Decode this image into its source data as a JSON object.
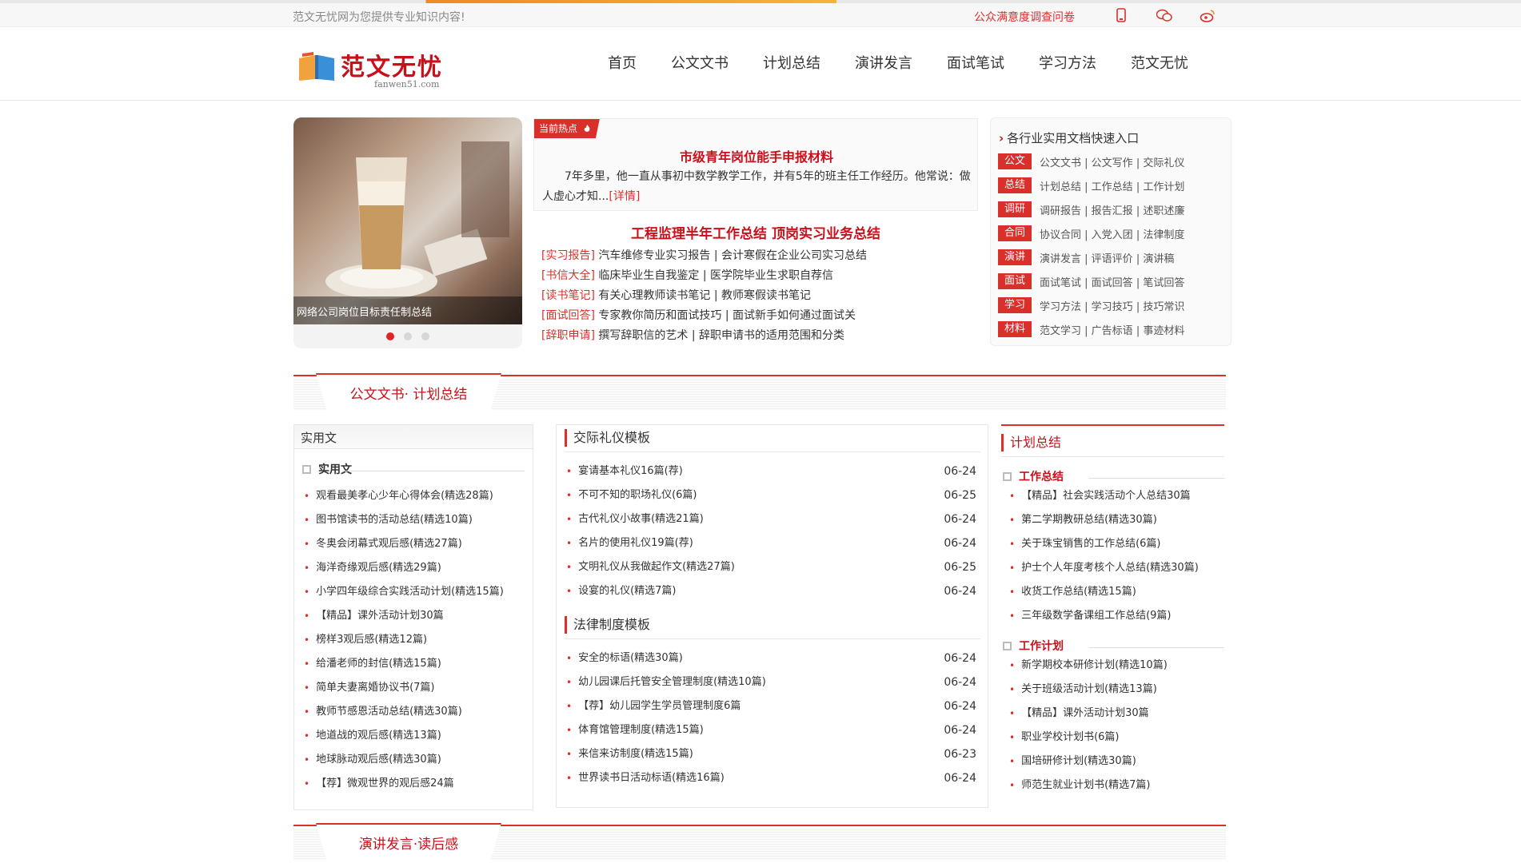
{
  "topbar": {
    "welcome": "范文无忧网为您提供专业知识内容!",
    "survey": "公众满意度调查问卷"
  },
  "logo": {
    "name": "范文无忧",
    "domain": "fanwen51.com"
  },
  "nav": [
    "首页",
    "公文文书",
    "计划总结",
    "演讲发言",
    "面试笔试",
    "学习方法",
    "范文无忧"
  ],
  "slider": {
    "caption": "网络公司岗位目标责任制总结",
    "slide_count": 3,
    "active": 1
  },
  "hot": {
    "tag": "当前热点",
    "title": "市级青年岗位能手申报材料",
    "desc": "7年多里，他一直从事初中数学教学工作，并有5年的班主任工作经历。他常说：做人虚心才知...",
    "more": "[详情]"
  },
  "headline": "工程监理半年工作总结 顶岗实习业务总结",
  "hotlist": [
    {
      "cat": "[实习报告]",
      "links": [
        "汽车维修专业实习报告",
        "会计寒假在企业公司实习总结"
      ]
    },
    {
      "cat": "[书信大全]",
      "links": [
        "临床毕业生自我鉴定",
        "医学院毕业生求职自荐信"
      ]
    },
    {
      "cat": "[读书笔记]",
      "links": [
        "有关心理教师读书笔记",
        "教师寒假读书笔记"
      ]
    },
    {
      "cat": "[面试回答]",
      "links": [
        "专家教你简历和面试技巧",
        "面试新手如何通过面试关"
      ]
    },
    {
      "cat": "[辞职申请]",
      "links": [
        "撰写辞职信的艺术",
        "辞职申请书的适用范围和分类"
      ]
    }
  ],
  "quick": {
    "title": "各行业实用文档快速入口",
    "rows": [
      {
        "tag": "公文",
        "links": [
          "公文文书",
          "公文写作",
          "交际礼仪"
        ]
      },
      {
        "tag": "总结",
        "links": [
          "计划总结",
          "工作总结",
          "工作计划"
        ]
      },
      {
        "tag": "调研",
        "links": [
          "调研报告",
          "报告汇报",
          "述职述廉"
        ]
      },
      {
        "tag": "合同",
        "links": [
          "协议合同",
          "入党入团",
          "法律制度"
        ]
      },
      {
        "tag": "演讲",
        "links": [
          "演讲发言",
          "评语评价",
          "演讲稿"
        ]
      },
      {
        "tag": "面试",
        "links": [
          "面试笔试",
          "面试回答",
          "笔试回答"
        ]
      },
      {
        "tag": "学习",
        "links": [
          "学习方法",
          "学习技巧",
          "技巧常识"
        ]
      },
      {
        "tag": "材料",
        "links": [
          "范文学习",
          "广告标语",
          "事迹材料"
        ]
      }
    ]
  },
  "section1": {
    "title": "公文文书· 计划总结"
  },
  "section2": {
    "title": "演讲发言·读后感"
  },
  "colA": {
    "header": "实用文",
    "subhead": "实用文",
    "items": [
      "观看最美孝心少年心得体会(精选28篇)",
      "图书馆读书的活动总结(精选10篇)",
      "冬奥会闭幕式观后感(精选27篇)",
      "海洋奇缘观后感(精选29篇)",
      "小学四年级综合实践活动计划(精选15篇)",
      "【精品】课外活动计划30篇",
      "榜样3观后感(精选12篇)",
      "给潘老师的封信(精选15篇)",
      "简单夫妻离婚协议书(7篇)",
      "教师节感恩活动总结(精选30篇)",
      "地道战的观后感(精选13篇)",
      "地球脉动观后感(精选30篇)",
      "【荐】微观世界的观后感24篇"
    ]
  },
  "colB": {
    "group1": {
      "title": "交际礼仪模板",
      "items": [
        {
          "text": "宴请基本礼仪16篇(荐)",
          "date": "06-24"
        },
        {
          "text": "不可不知的职场礼仪(6篇)",
          "date": "06-25"
        },
        {
          "text": "古代礼仪小故事(精选21篇)",
          "date": "06-24"
        },
        {
          "text": "名片的使用礼仪19篇(荐)",
          "date": "06-24"
        },
        {
          "text": "文明礼仪从我做起作文(精选27篇)",
          "date": "06-25"
        },
        {
          "text": "设宴的礼仪(精选7篇)",
          "date": "06-24"
        }
      ]
    },
    "group2": {
      "title": "法律制度模板",
      "items": [
        {
          "text": "安全的标语(精选30篇)",
          "date": "06-24"
        },
        {
          "text": "幼儿园课后托管安全管理制度(精选10篇)",
          "date": "06-24"
        },
        {
          "text": "【荐】幼儿园学生学员管理制度6篇",
          "date": "06-24"
        },
        {
          "text": "体育馆管理制度(精选15篇)",
          "date": "06-24"
        },
        {
          "text": "来信来访制度(精选15篇)",
          "date": "06-23"
        },
        {
          "text": "世界读书日活动标语(精选16篇)",
          "date": "06-24"
        }
      ]
    }
  },
  "colC": {
    "header": "计划总结",
    "sub1": {
      "title": "工作总结",
      "items": [
        "【精品】社会实践活动个人总结30篇",
        "第二学期教研总结(精选30篇)",
        "关于珠宝销售的工作总结(6篇)",
        "护士个人年度考核个人总结(精选30篇)",
        "收货工作总结(精选15篇)",
        "三年级数学备课组工作总结(9篇)"
      ]
    },
    "sub2": {
      "title": "工作计划",
      "items": [
        "新学期校本研修计划(精选10篇)",
        "关于班级活动计划(精选13篇)",
        "【精品】课外活动计划30篇",
        "职业学校计划书(6篇)",
        "国培研修计划(精选30篇)",
        "师范生就业计划书(精选7篇)"
      ]
    }
  },
  "icons": [
    "mobile-icon",
    "wechat-icon",
    "weibo-icon",
    "flame-icon",
    "chevron-right-icon",
    "book-logo-icon"
  ],
  "colors": {
    "accent": "#d9302c",
    "title_red": "#c8101a",
    "top_orange": "#f08a24"
  }
}
